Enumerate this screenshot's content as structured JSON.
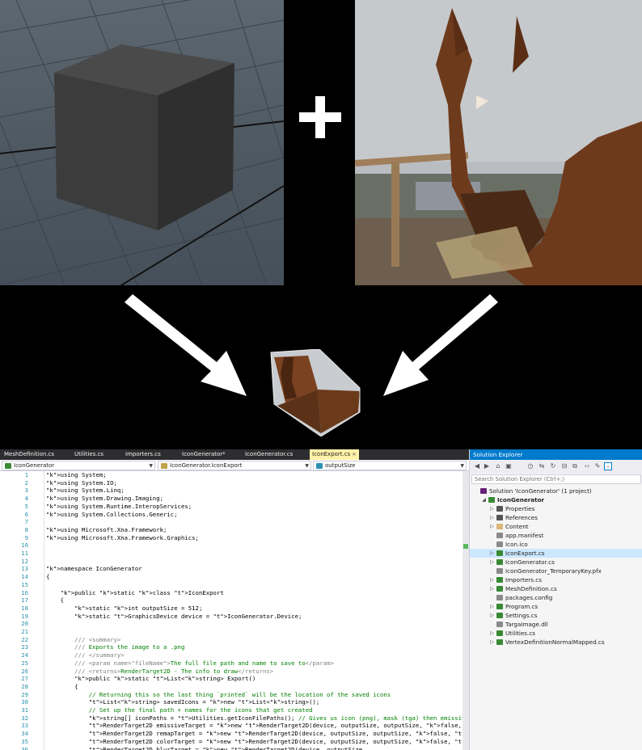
{
  "banner": {
    "plus_symbol": "+"
  },
  "editor": {
    "tabs": [
      {
        "label": "MeshDefinition.cs",
        "active": false
      },
      {
        "label": "Utilities.cs",
        "active": false
      },
      {
        "label": "Importers.cs",
        "active": false
      },
      {
        "label": "IconGenerator*",
        "active": false
      },
      {
        "label": "IconGenerator.cs",
        "active": false
      },
      {
        "label": "IconExport.cs",
        "active": true
      }
    ],
    "close_glyph": "✕",
    "nav": {
      "project": "IconGenerator",
      "type": "IconGenerator.IconExport",
      "member": "outputSize"
    },
    "lines": [
      {
        "n": "1",
        "t": "using System;"
      },
      {
        "n": "2",
        "t": "using System.IO;"
      },
      {
        "n": "3",
        "t": "using System.Linq;"
      },
      {
        "n": "4",
        "t": "using System.Drawing.Imaging;"
      },
      {
        "n": "5",
        "t": "using System.Runtime.InteropServices;"
      },
      {
        "n": "6",
        "t": "using System.Collections.Generic;"
      },
      {
        "n": "7",
        "t": ""
      },
      {
        "n": "8",
        "t": "using Microsoft.Xna.Framework;"
      },
      {
        "n": "9",
        "t": "using Microsoft.Xna.Framework.Graphics;"
      },
      {
        "n": "10",
        "t": ""
      },
      {
        "n": "11",
        "t": ""
      },
      {
        "n": "12",
        "t": ""
      },
      {
        "n": "13",
        "t": "namespace IconGenerator"
      },
      {
        "n": "14",
        "t": "{"
      },
      {
        "n": "15",
        "t": ""
      },
      {
        "n": "16",
        "t": "    public static class IconExport"
      },
      {
        "n": "17",
        "t": "    {"
      },
      {
        "n": "18",
        "t": "        static int outputSize = 512;"
      },
      {
        "n": "19",
        "t": "        static GraphicsDevice device = IconGenerator.Device;"
      },
      {
        "n": "20",
        "t": ""
      },
      {
        "n": "21",
        "t": ""
      },
      {
        "n": "22",
        "t": "        /// <summary>"
      },
      {
        "n": "23",
        "t": "        /// Exports the image to a .png"
      },
      {
        "n": "24",
        "t": "        /// </summary>"
      },
      {
        "n": "25",
        "t": "        /// <param name=\"fileName\">The full file path and name to save to</param>"
      },
      {
        "n": "26",
        "t": "        /// <returns>RenderTarget2D - The info to draw</returns>"
      },
      {
        "n": "27",
        "t": "        public static List<string> Export()"
      },
      {
        "n": "28",
        "t": "        {"
      },
      {
        "n": "29",
        "t": "            // Returning this so the last thing `printed` will be the location of the saved icons"
      },
      {
        "n": "30",
        "t": "            List<string> savedIcons = new List<string>();"
      },
      {
        "n": "31",
        "t": "            // Set up the final path + names for the icons that get created"
      },
      {
        "n": "32",
        "t": "            string[] iconPaths = Utilities.getIconFilePaths(); // Gives us icon (png), mask (tga) then emissive (png)"
      },
      {
        "n": "33",
        "t": "            RenderTarget2D emissiveTarget = new RenderTarget2D(device, outputSize, outputSize, false, SurfaceFormat.Col"
      },
      {
        "n": "34",
        "t": "            RenderTarget2D remapTarget = new RenderTarget2D(device, outputSize, outputSize, false, SurfaceFormat.Color,"
      },
      {
        "n": "35",
        "t": "            RenderTarget2D colorTarget = new RenderTarget2D(device, outputSize, outputSize, false, SurfaceFormat.Color,"
      },
      {
        "n": "36",
        "t": "            RenderTarget2D blurTarget = new RenderTarget2D(device, outputSize"
      }
    ]
  },
  "solution_explorer": {
    "title": "Solution Explorer",
    "search_placeholder": "Search Solution Explorer (Ctrl+;)",
    "nodes": [
      {
        "label": "Solution 'IconGenerator' (1 project)",
        "indent": 0,
        "arrow": "",
        "icon": "solution-icon",
        "color": "#68217a",
        "bold": false,
        "selected": false
      },
      {
        "label": "IconGenerator",
        "indent": 1,
        "arrow": "◢",
        "icon": "csharp-project-icon",
        "color": "#388a34",
        "bold": true,
        "selected": false
      },
      {
        "label": "Properties",
        "indent": 2,
        "arrow": "▷",
        "icon": "wrench-icon",
        "color": "#555555",
        "bold": false,
        "selected": false
      },
      {
        "label": "References",
        "indent": 2,
        "arrow": "▷",
        "icon": "references-icon",
        "color": "#555555",
        "bold": false,
        "selected": false
      },
      {
        "label": "Content",
        "indent": 2,
        "arrow": "▷",
        "icon": "folder-icon",
        "color": "#dcb67a",
        "bold": false,
        "selected": false
      },
      {
        "label": "app.manifest",
        "indent": 2,
        "arrow": "",
        "icon": "file-icon",
        "color": "#8a8a8a",
        "bold": false,
        "selected": false
      },
      {
        "label": "Icon.ico",
        "indent": 2,
        "arrow": "",
        "icon": "image-file-icon",
        "color": "#8a8a8a",
        "bold": false,
        "selected": false
      },
      {
        "label": "IconExport.cs",
        "indent": 2,
        "arrow": "▷",
        "icon": "csharp-file-icon",
        "color": "#388a34",
        "bold": false,
        "selected": true
      },
      {
        "label": "IconGenerator.cs",
        "indent": 2,
        "arrow": "▷",
        "icon": "csharp-file-icon",
        "color": "#388a34",
        "bold": false,
        "selected": false
      },
      {
        "label": "IconGenerator_TemporaryKey.pfx",
        "indent": 2,
        "arrow": "",
        "icon": "key-file-icon",
        "color": "#8a8a8a",
        "bold": false,
        "selected": false
      },
      {
        "label": "Importers.cs",
        "indent": 2,
        "arrow": "▷",
        "icon": "csharp-file-icon",
        "color": "#388a34",
        "bold": false,
        "selected": false
      },
      {
        "label": "MeshDefinition.cs",
        "indent": 2,
        "arrow": "▷",
        "icon": "csharp-file-icon",
        "color": "#388a34",
        "bold": false,
        "selected": false
      },
      {
        "label": "packages.config",
        "indent": 2,
        "arrow": "",
        "icon": "config-file-icon",
        "color": "#8a8a8a",
        "bold": false,
        "selected": false
      },
      {
        "label": "Program.cs",
        "indent": 2,
        "arrow": "▷",
        "icon": "csharp-file-icon",
        "color": "#388a34",
        "bold": false,
        "selected": false
      },
      {
        "label": "Settings.cs",
        "indent": 2,
        "arrow": "▷",
        "icon": "csharp-file-icon",
        "color": "#388a34",
        "bold": false,
        "selected": false
      },
      {
        "label": "TargaImage.dll",
        "indent": 2,
        "arrow": "",
        "icon": "dll-file-icon",
        "color": "#8a8a8a",
        "bold": false,
        "selected": false
      },
      {
        "label": "Utilities.cs",
        "indent": 2,
        "arrow": "▷",
        "icon": "csharp-file-icon",
        "color": "#388a34",
        "bold": false,
        "selected": false
      },
      {
        "label": "VertexDefinitionNormalMapped.cs",
        "indent": 2,
        "arrow": "▷",
        "icon": "csharp-file-icon",
        "color": "#388a34",
        "bold": false,
        "selected": false
      }
    ]
  },
  "colors": {
    "accent": "#007acc",
    "active_tab": "#fff1a8",
    "keyword": "#0000ff",
    "type": "#2b91af",
    "comment": "#008000",
    "string": "#a31515"
  }
}
